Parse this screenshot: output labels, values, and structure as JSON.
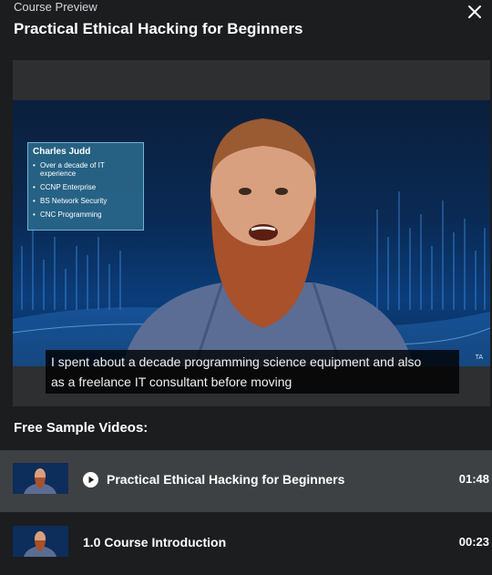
{
  "header": {
    "eyebrow": "Course Preview",
    "title": "Practical Ethical Hacking for Beginners"
  },
  "player": {
    "lower_third": {
      "name": "Charles Judd",
      "items": [
        "Over a decade of IT experience",
        "CCNP Enterprise",
        "BS Network Security",
        "CNC Programming"
      ]
    },
    "caption_lines": [
      "I spent about a decade programming science equipment and also",
      "as a freelance IT consultant before moving"
    ],
    "watermark": "TA"
  },
  "samples": {
    "title": "Free Sample Videos:",
    "items": [
      {
        "label": "Practical Ethical Hacking for Beginners",
        "duration": "01:48",
        "active": true
      },
      {
        "label": "1.0 Course Introduction",
        "duration": "00:23",
        "active": false
      }
    ]
  },
  "colors": {
    "background": "#1c1d1f",
    "active_row": "#3e4143",
    "lower_third": "#2b6c8e"
  }
}
